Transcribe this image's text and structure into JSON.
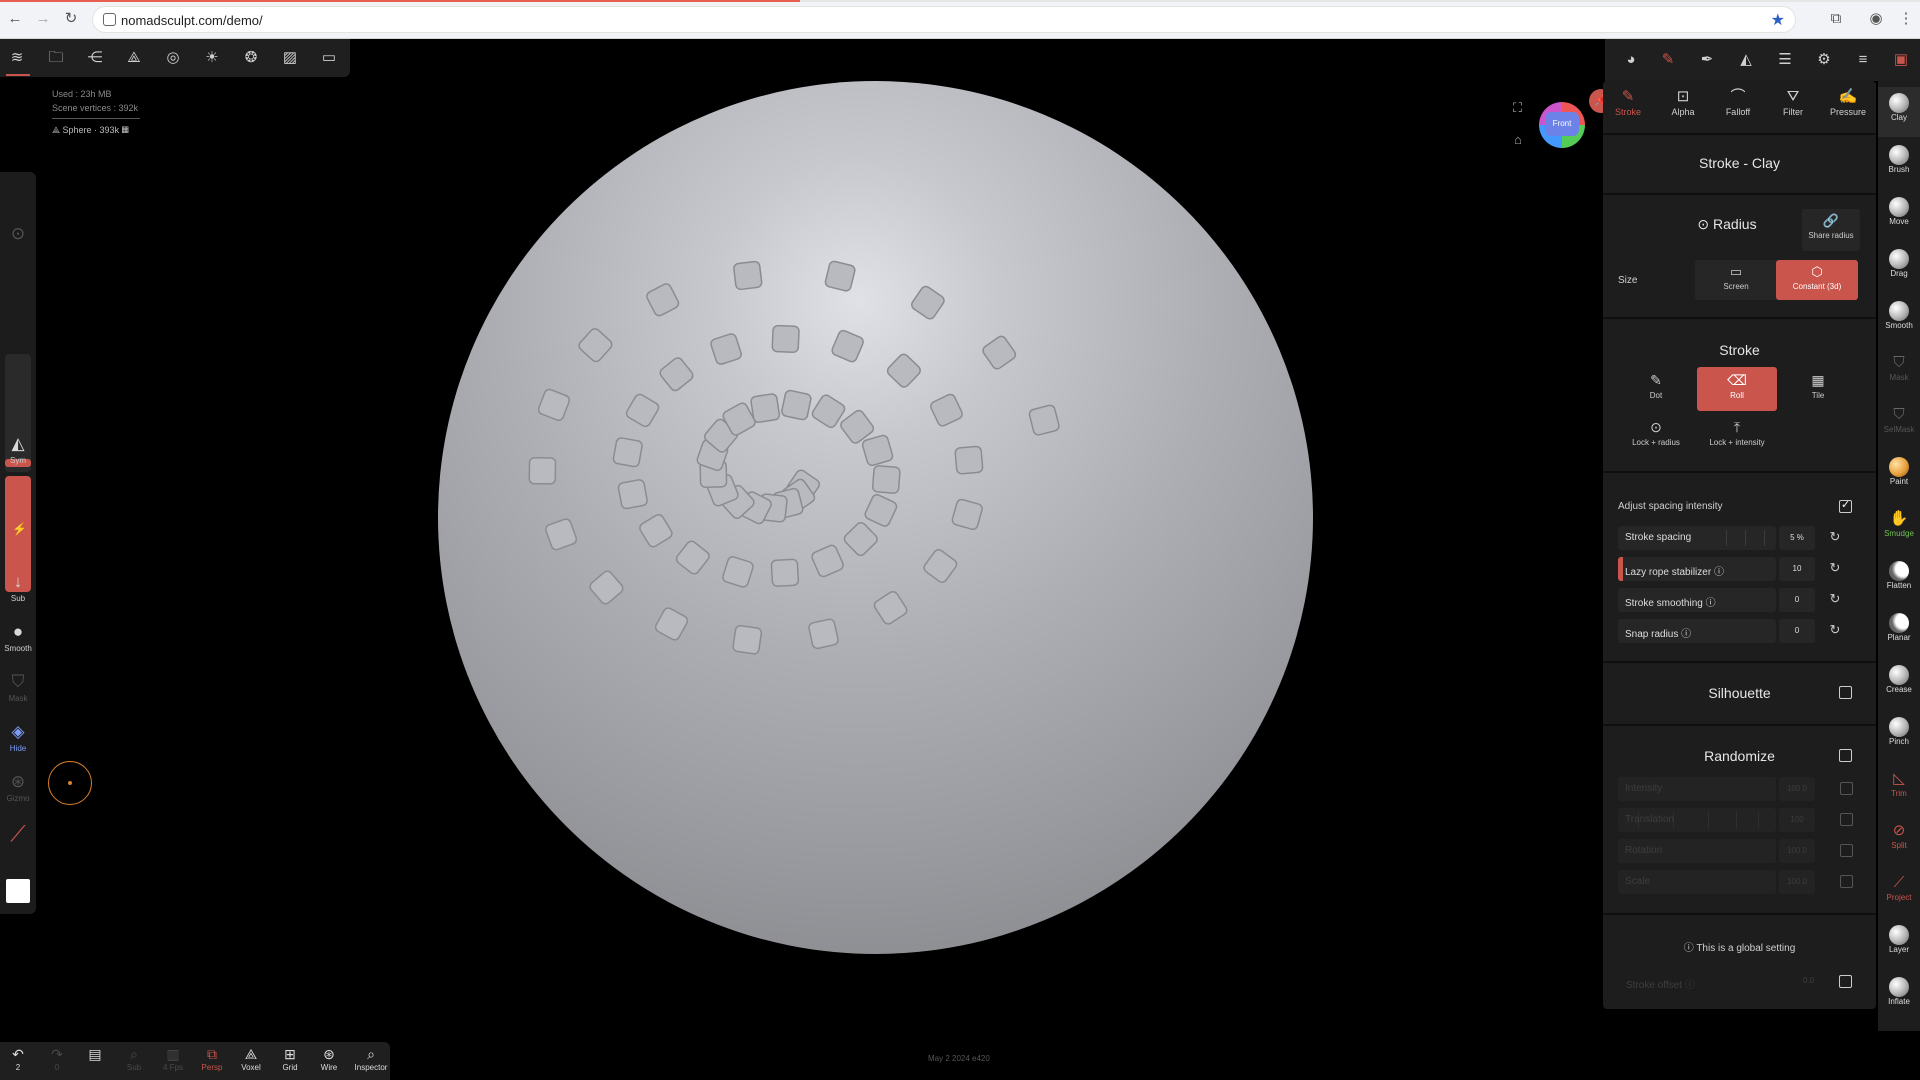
{
  "browser": {
    "url": "nomadsculpt.com/demo/",
    "icons": [
      "back-arrow-icon",
      "forward-arrow-icon",
      "reload-icon",
      "site-info-icon",
      "bookmark-star-icon",
      "extensions-icon",
      "profile-icon",
      "more-menu-icon"
    ]
  },
  "scene_info": {
    "memory": "Used : 23h MB",
    "vertices": "Scene vertices : 392k",
    "object": "Sphere · 393k"
  },
  "top_toolbar": {
    "icons": [
      "nomad-logo-icon",
      "folder-icon",
      "scene-graph-icon",
      "mesh-icon",
      "globe-icon",
      "light-icon",
      "material-icon",
      "image-icon",
      "camera-icon"
    ]
  },
  "left_toolbar": {
    "sym_label": "Sym",
    "sub_label": "Sub",
    "smooth_label": "Smooth",
    "mask_label": "Mask",
    "hide_label": "Hide",
    "gizmo_label": "Gizmo",
    "radius_level": 0.9,
    "intensity_level": 1.0
  },
  "viewport": {
    "view_cube_label": "Front"
  },
  "panel": {
    "tabs": [
      {
        "label": "Stroke",
        "icon": "brush-icon",
        "active": true
      },
      {
        "label": "Alpha",
        "icon": "alpha-icon"
      },
      {
        "label": "Falloff",
        "icon": "falloff-icon"
      },
      {
        "label": "Filter",
        "icon": "filter-icon"
      },
      {
        "label": "Pressure",
        "icon": "pressure-icon"
      }
    ],
    "title": "Stroke - Clay",
    "radius": {
      "title": "Radius",
      "share_label": "Share radius",
      "size_label": "Size",
      "screen_label": "Screen",
      "constant_label": "Constant (3d)"
    },
    "stroke": {
      "title": "Stroke",
      "dot_label": "Dot",
      "roll_label": "Roll",
      "tile_label": "Tile",
      "lock_radius_label": "Lock + radius",
      "lock_intensity_label": "Lock + intensity"
    },
    "adjust_spacing_label": "Adjust spacing intensity",
    "adjust_spacing_checked": true,
    "sliders": [
      {
        "label": "Stroke spacing",
        "value": "5 %"
      },
      {
        "label": "Lazy rope stabilizer",
        "value": "10"
      },
      {
        "label": "Stroke smoothing",
        "value": "0"
      },
      {
        "label": "Snap radius",
        "value": "0"
      }
    ],
    "silhouette_label": "Silhouette",
    "randomize_label": "Randomize",
    "randomize_rows": [
      {
        "label": "Intensity",
        "value": "100.0"
      },
      {
        "label": "Translation",
        "value": "100"
      },
      {
        "label": "Rotation",
        "value": "100.0"
      },
      {
        "label": "Scale",
        "value": "100.0"
      }
    ],
    "global_setting_label": "This is a global setting",
    "stroke_offset_label": "Stroke offset",
    "stroke_offset_value": "0.0"
  },
  "tools": [
    {
      "label": "Clay",
      "kind": "ball",
      "active": true
    },
    {
      "label": "Brush",
      "kind": "ball"
    },
    {
      "label": "Move",
      "kind": "ball"
    },
    {
      "label": "Drag",
      "kind": "ball"
    },
    {
      "label": "Smooth",
      "kind": "ball"
    },
    {
      "label": "Mask",
      "kind": "glyph",
      "glyph": "⛉",
      "style": "dim"
    },
    {
      "label": "SelMask",
      "kind": "glyph",
      "glyph": "⛉",
      "style": "dim"
    },
    {
      "label": "Paint",
      "kind": "orange"
    },
    {
      "label": "Smudge",
      "kind": "glyph",
      "glyph": "✋",
      "style": "green"
    },
    {
      "label": "Flatten",
      "kind": "moon"
    },
    {
      "label": "Planar",
      "kind": "moon"
    },
    {
      "label": "Crease",
      "kind": "ball"
    },
    {
      "label": "Pinch",
      "kind": "ball"
    },
    {
      "label": "Trim",
      "kind": "glyph",
      "glyph": "◺",
      "style": "red"
    },
    {
      "label": "Split",
      "kind": "glyph",
      "glyph": "⊘",
      "style": "red"
    },
    {
      "label": "Project",
      "kind": "glyph",
      "glyph": "⟋",
      "style": "red"
    },
    {
      "label": "Layer",
      "kind": "ball"
    },
    {
      "label": "Inflate",
      "kind": "ball"
    }
  ],
  "bottom_toolbar": {
    "undo_label": "2",
    "redo_label": "0",
    "voxel_label": "Voxel",
    "grid_label": "Grid",
    "wire_label": "Wire",
    "inspector_label": "Inspector",
    "persp_label": "Persp",
    "sub_label": "Sub",
    "fps_label": "4 Fps"
  },
  "footer": {
    "date": "May 2 2024 e420"
  },
  "colors": {
    "accent": "#c9554c",
    "panel_bg": "#1d1d1d",
    "sphere": "#b2b3b8",
    "cursor_ring": "#d7812d"
  }
}
